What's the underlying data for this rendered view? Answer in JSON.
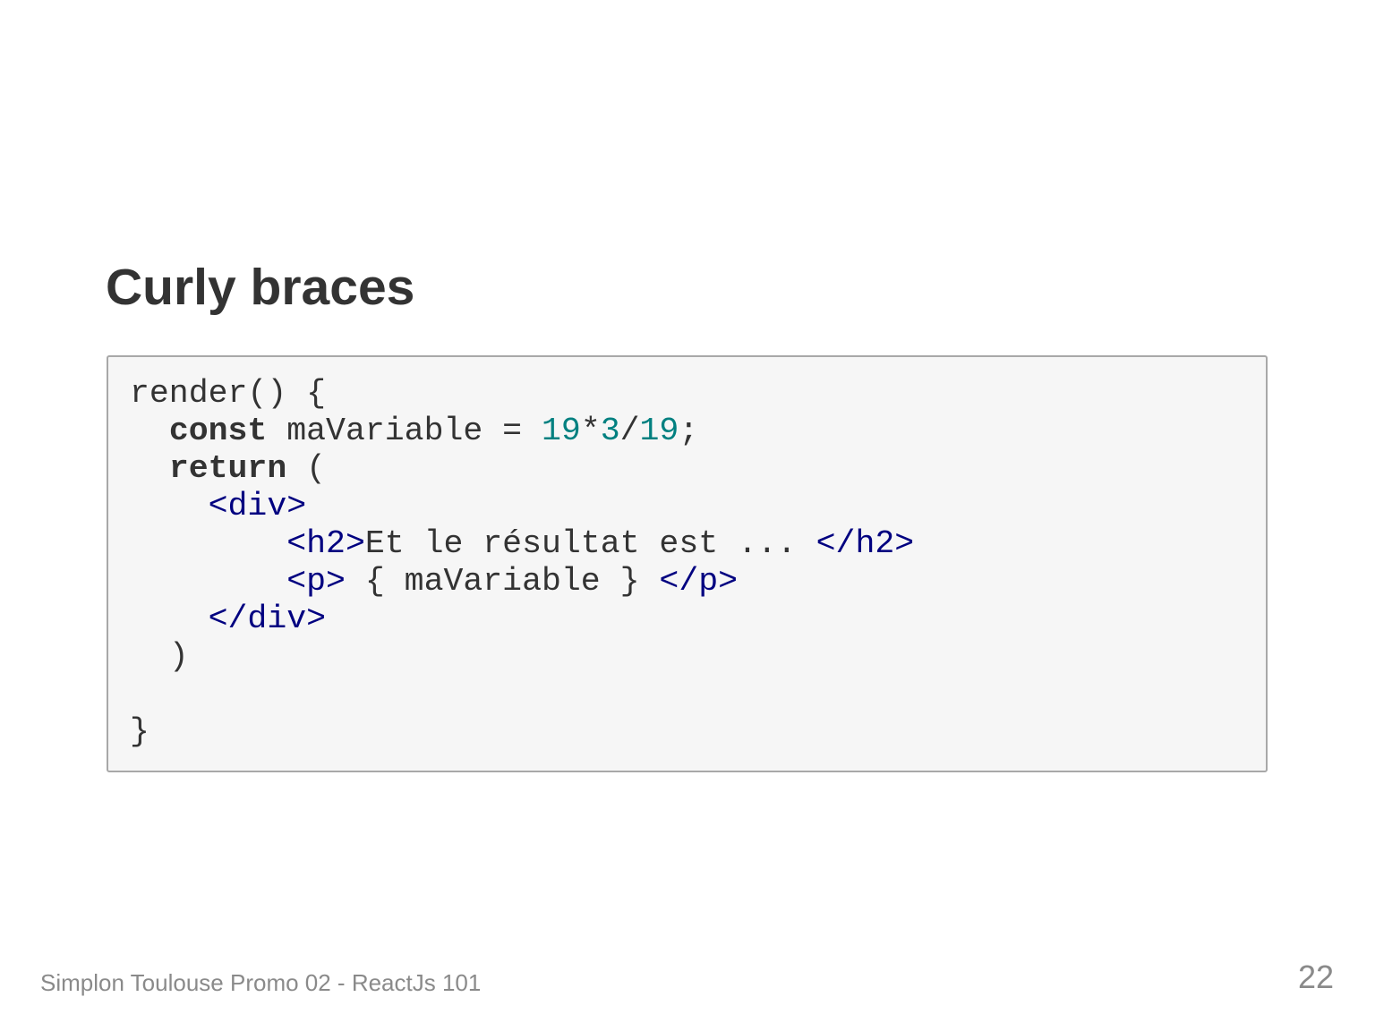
{
  "slide": {
    "title": "Curly braces",
    "footer": "Simplon Toulouse Promo 02 - ReactJs 101",
    "page_number": "22"
  },
  "code": {
    "language": "jsx",
    "colors": {
      "text": "#333333",
      "keyword": "#333333",
      "number": "#008080",
      "tag": "#000080",
      "background": "#f6f6f6",
      "border": "#a8a8a8"
    },
    "lines": [
      [
        {
          "t": "text",
          "v": "render() {"
        }
      ],
      [
        {
          "t": "text",
          "v": "  "
        },
        {
          "t": "kw",
          "v": "const"
        },
        {
          "t": "text",
          "v": " maVariable = "
        },
        {
          "t": "num",
          "v": "19"
        },
        {
          "t": "text",
          "v": "*"
        },
        {
          "t": "num",
          "v": "3"
        },
        {
          "t": "text",
          "v": "/"
        },
        {
          "t": "num",
          "v": "19"
        },
        {
          "t": "text",
          "v": ";"
        }
      ],
      [
        {
          "t": "text",
          "v": "  "
        },
        {
          "t": "kw",
          "v": "return"
        },
        {
          "t": "text",
          "v": " ("
        }
      ],
      [
        {
          "t": "text",
          "v": "    "
        },
        {
          "t": "tag",
          "v": "<div>"
        }
      ],
      [
        {
          "t": "text",
          "v": "        "
        },
        {
          "t": "tag",
          "v": "<h2>"
        },
        {
          "t": "text",
          "v": "Et le résultat est ... "
        },
        {
          "t": "tag",
          "v": "</h2>"
        }
      ],
      [
        {
          "t": "text",
          "v": "        "
        },
        {
          "t": "tag",
          "v": "<p>"
        },
        {
          "t": "text",
          "v": " { maVariable } "
        },
        {
          "t": "tag",
          "v": "</p>"
        }
      ],
      [
        {
          "t": "text",
          "v": "    "
        },
        {
          "t": "tag",
          "v": "</div>"
        }
      ],
      [
        {
          "t": "text",
          "v": "  )"
        }
      ],
      [],
      [
        {
          "t": "text",
          "v": "}"
        }
      ]
    ]
  }
}
